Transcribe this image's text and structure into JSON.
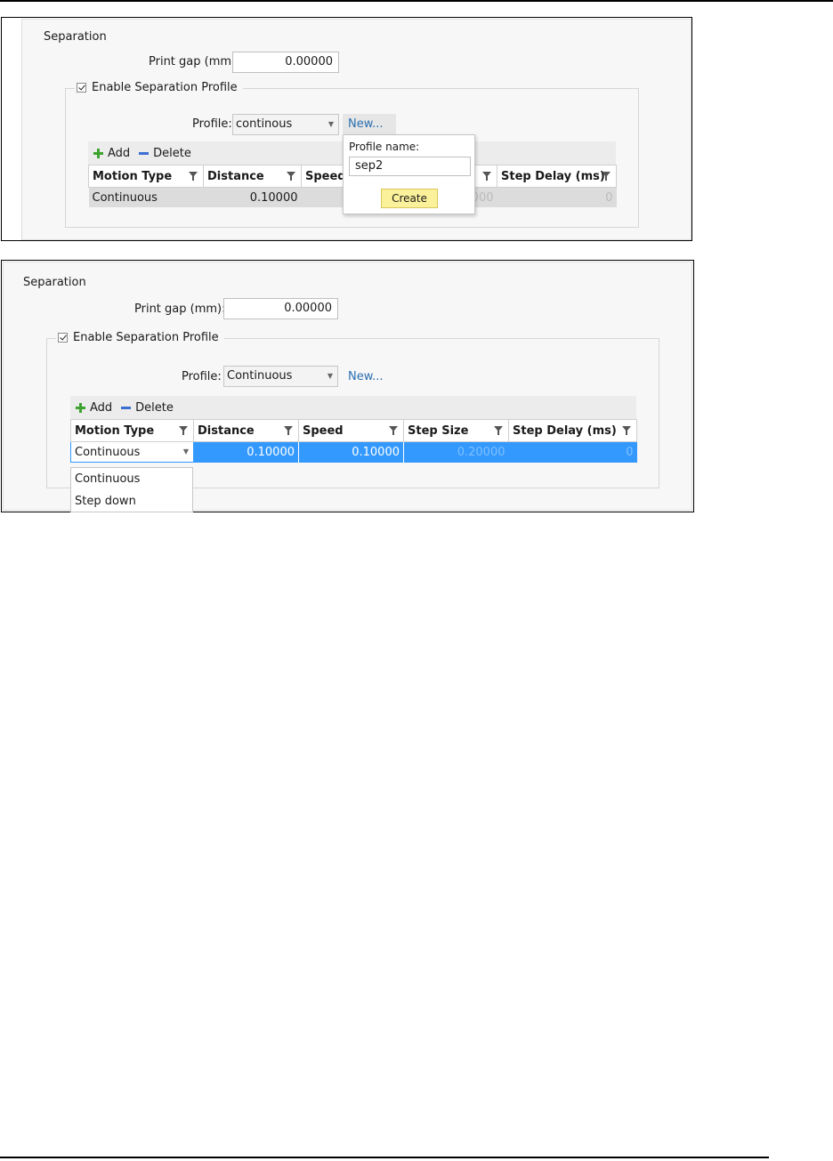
{
  "screenshot1": {
    "section_title": "Separation",
    "print_gap_label": "Print gap (mm):",
    "print_gap_value": "0.00000",
    "enable_label": "Enable Separation Profile",
    "enable_checked": true,
    "profile_label": "Profile:",
    "profile_value": "continous",
    "new_link": "New...",
    "toolbar": {
      "add_label": "Add",
      "delete_label": "Delete"
    },
    "columns": [
      "Motion Type",
      "Distance",
      "Speed",
      "Step Delay (ms)"
    ],
    "row": {
      "motion_type": "Continuous",
      "distance": "0.10000",
      "faded_value": "000",
      "step_delay": "0"
    },
    "popup": {
      "label": "Profile name:",
      "input_value": "sep2",
      "create_label": "Create"
    }
  },
  "screenshot2": {
    "section_title": "Separation",
    "print_gap_label": "Print gap (mm):",
    "print_gap_value": "0.00000",
    "enable_label": "Enable Separation Profile",
    "enable_checked": true,
    "profile_label": "Profile:",
    "profile_value": "Continuous",
    "new_link": "New...",
    "toolbar": {
      "add_label": "Add",
      "delete_label": "Delete"
    },
    "columns": [
      "Motion Type",
      "Distance",
      "Speed",
      "Step Size",
      "Step Delay (ms)"
    ],
    "row": {
      "motion_type": "Continuous",
      "distance": "0.10000",
      "speed": "0.10000",
      "step_size": "0.20000",
      "step_delay": "0"
    },
    "dropdown_options": [
      "Continuous",
      "Step down"
    ]
  },
  "colors": {
    "link": "#2a6fb0",
    "selection": "#3399ff",
    "create_button": "#fbf19a",
    "add_icon": "#3da22f",
    "delete_icon": "#3b6fd2"
  }
}
